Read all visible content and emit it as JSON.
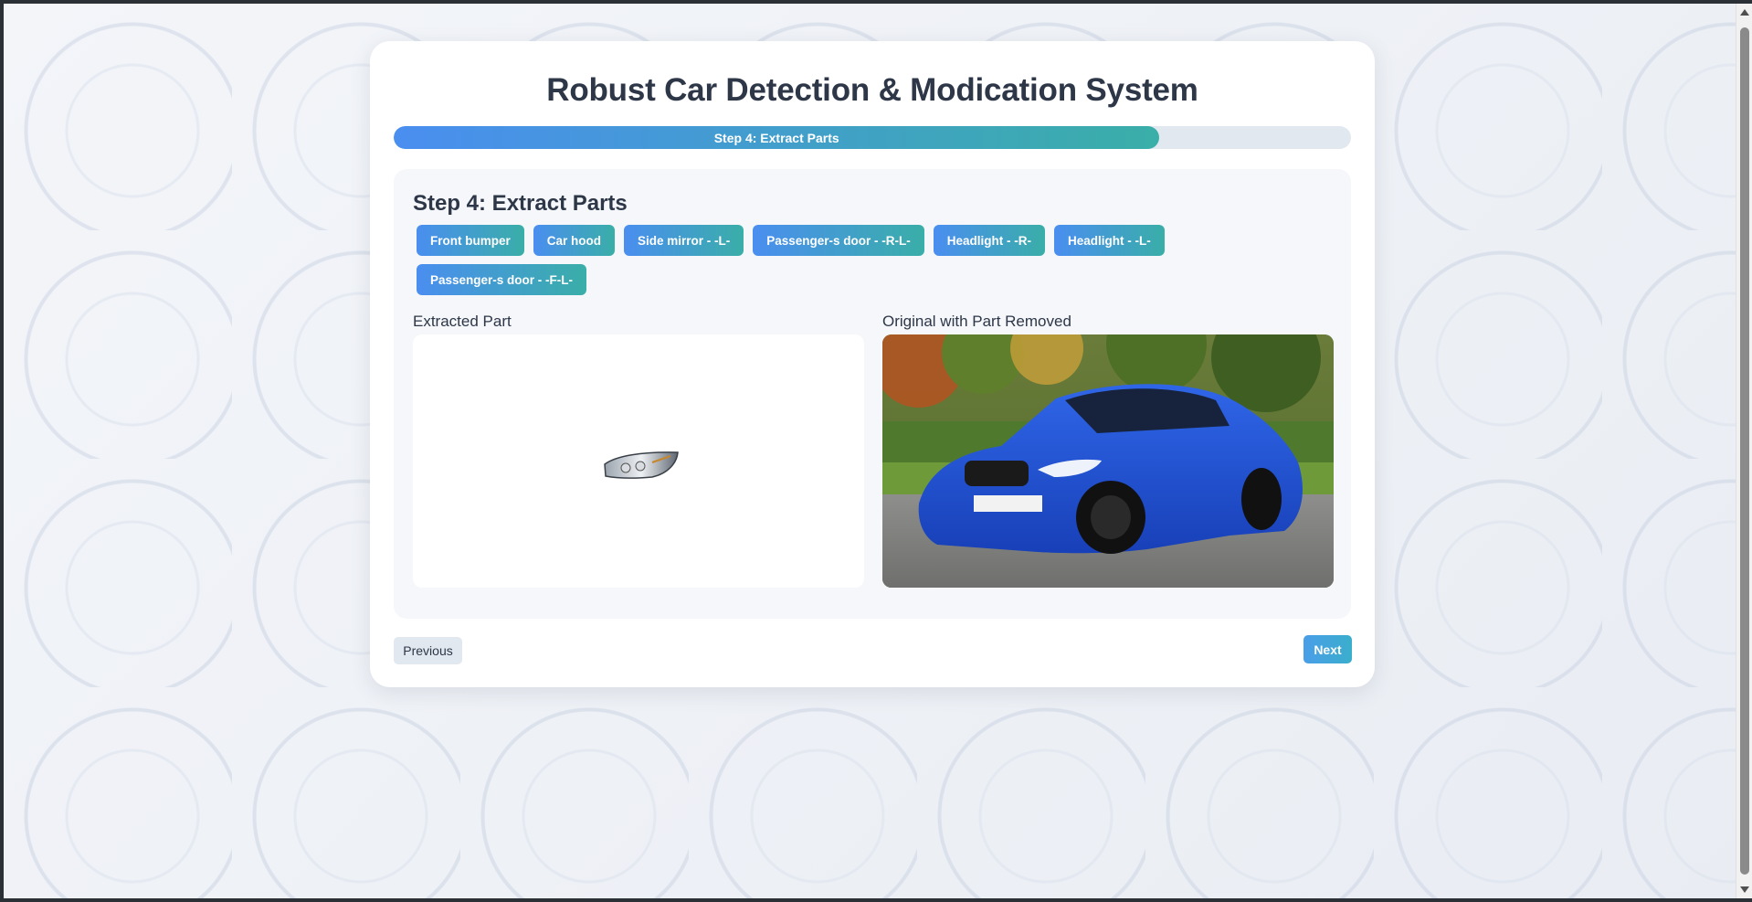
{
  "app": {
    "title": "Robust Car Detection & Modication System"
  },
  "progress": {
    "label": "Step 4: Extract Parts",
    "fraction": 0.8
  },
  "step": {
    "heading": "Step 4: Extract Parts",
    "parts": [
      "Front bumper",
      "Car hood",
      "Side mirror - -L-",
      "Passenger-s door - -R-L-",
      "Headlight - -R-",
      "Headlight - -L-",
      "Passenger-s door - -F-L-"
    ],
    "extracted_label": "Extracted Part",
    "original_label": "Original with Part Removed"
  },
  "nav": {
    "previous_label": "Previous",
    "next_label": "Next"
  },
  "colors": {
    "accent_start": "#4a8ef0",
    "accent_end": "#3aaea8",
    "heading": "#2d3748",
    "car_blue": "#1f4fd1"
  },
  "icons": {
    "scroll_up": "arrow-up-icon",
    "scroll_down": "arrow-down-icon"
  }
}
